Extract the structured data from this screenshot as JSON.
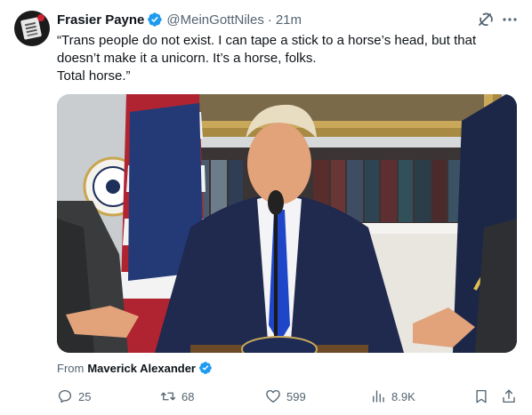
{
  "author": {
    "name": "Frasier Payne",
    "handle": "@MeinGottNiles",
    "separator": "·",
    "time": "21m",
    "verified_color": "#1d9bf0"
  },
  "tweet": {
    "text": "“Trans people do not exist. I can tape a stick to a horse’s head, but that doesn’t make it a unicorn. It’s a horse, folks.\nTotal horse.”"
  },
  "media": {
    "type": "video-still",
    "seal_text": "DENT OF THE"
  },
  "source": {
    "prefix": "From",
    "name": "Maverick Alexander"
  },
  "actions": {
    "replies": "25",
    "reposts": "68",
    "likes": "599",
    "views": "8.9K"
  },
  "icons": [
    "verified-badge-icon",
    "grok-icon",
    "more-icon",
    "reply-icon",
    "repost-icon",
    "like-icon",
    "views-icon",
    "bookmark-icon",
    "share-icon"
  ],
  "colors": {
    "text": "#0f1419",
    "secondary": "#536471",
    "accent": "#1d9bf0"
  }
}
